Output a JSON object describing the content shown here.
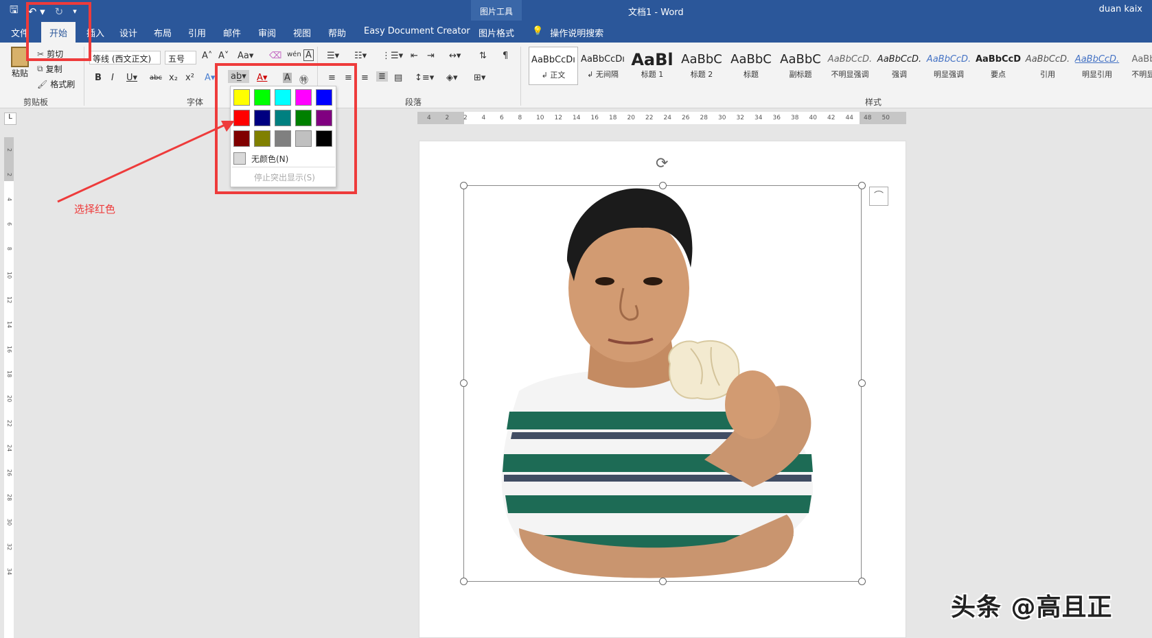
{
  "window": {
    "doc_title": "文档1  -  Word",
    "user": "duan kaix",
    "contextual_label": "图片工具"
  },
  "qat": {
    "save_icon": "save-icon",
    "undo_icon": "undo-icon",
    "redo_icon": "redo-icon"
  },
  "tabs": [
    "文件",
    "开始",
    "插入",
    "设计",
    "布局",
    "引用",
    "邮件",
    "审阅",
    "视图",
    "帮助",
    "Easy Document Creator",
    "图片格式"
  ],
  "tell_me": "操作说明搜索",
  "clipboard": {
    "paste": "粘贴",
    "cut": "剪切",
    "copy": "复制",
    "format_painter": "格式刷",
    "label": "剪贴板"
  },
  "font": {
    "name": "等线 (西文正文)",
    "size": "五号",
    "label": "字体"
  },
  "paragraph": {
    "label": "段落"
  },
  "styles": {
    "label": "样式",
    "items": [
      {
        "sample": "AaBbCcDı",
        "name": "↲ 正文"
      },
      {
        "sample": "AaBbCcDı",
        "name": "↲ 无间隔"
      },
      {
        "sample": "AaBl",
        "name": "标题 1"
      },
      {
        "sample": "AaBbC",
        "name": "标题 2"
      },
      {
        "sample": "AaBbC",
        "name": "标题"
      },
      {
        "sample": "AaBbC",
        "name": "副标题"
      },
      {
        "sample": "AaBbCcD.",
        "name": "不明显强调"
      },
      {
        "sample": "AaBbCcD.",
        "name": "强调"
      },
      {
        "sample": "AaBbCcD.",
        "name": "明显强调"
      },
      {
        "sample": "AaBbCcD",
        "name": "要点"
      },
      {
        "sample": "AaBbCcD.",
        "name": "引用"
      },
      {
        "sample": "AaBbCcD.",
        "name": "明显引用"
      },
      {
        "sample": "AaBbC",
        "name": "不明显..."
      }
    ]
  },
  "ruler": {
    "h_ticks": [
      "4",
      "2",
      "2",
      "4",
      "6",
      "8",
      "10",
      "12",
      "14",
      "16",
      "18",
      "20",
      "22",
      "24",
      "26",
      "28",
      "30",
      "32",
      "34",
      "36",
      "38",
      "40",
      "42",
      "44",
      "48",
      "50"
    ],
    "v_ticks": [
      "2",
      "2",
      "4",
      "6",
      "8",
      "10",
      "12",
      "14",
      "16",
      "18",
      "20",
      "22",
      "24",
      "26",
      "28",
      "30",
      "32",
      "34"
    ]
  },
  "highlight_menu": {
    "colors": [
      "#ffff00",
      "#00ff00",
      "#00ffff",
      "#ff00ff",
      "#0000ff",
      "#ff0000",
      "#000080",
      "#008080",
      "#008000",
      "#800080",
      "#800000",
      "#808000",
      "#808080",
      "#c0c0c0",
      "#000000"
    ],
    "no_color": "无颜色(N)",
    "stop": "停止突出显示(S)"
  },
  "annotation": {
    "text": "选择红色",
    "color": "#ee3b3b"
  },
  "watermark": "头条 @高且正"
}
